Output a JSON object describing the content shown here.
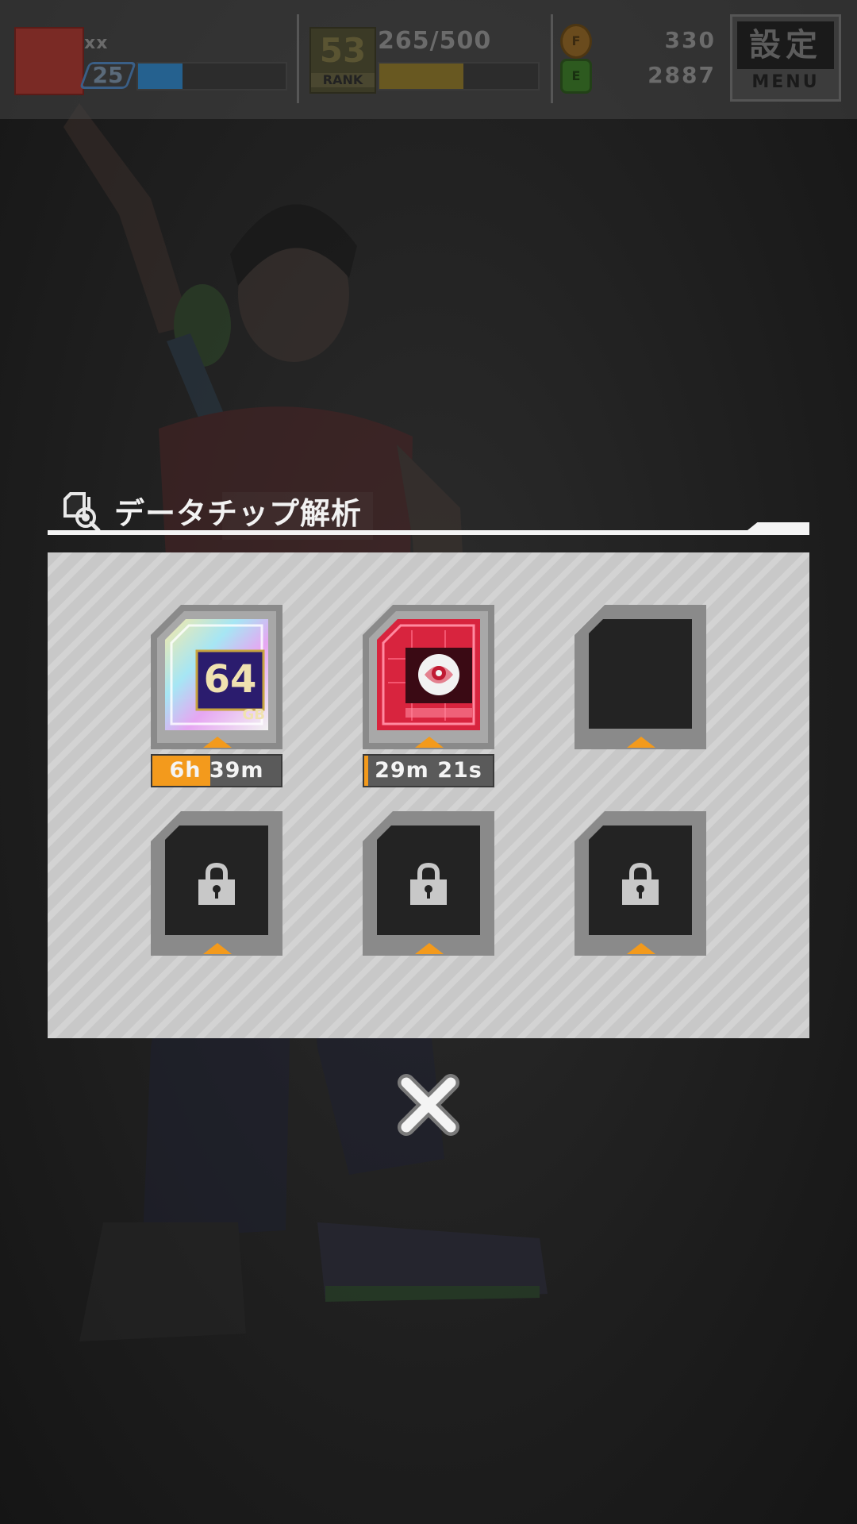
{
  "hud": {
    "player_name": "xx",
    "player_level": "25",
    "exp_progress": 0.3,
    "rank": {
      "number": "53",
      "label": "RANK"
    },
    "stamina_text": "265/500",
    "stamina_progress": 0.53,
    "currencies": [
      {
        "icon": "f-coin-icon",
        "letter": "F",
        "value": "330"
      },
      {
        "icon": "e-can-icon",
        "letter": "E",
        "value": "2887"
      }
    ],
    "menu": {
      "kanji": "設定",
      "label": "MENU"
    }
  },
  "modal": {
    "title": "データチップ解析",
    "title_icon": "chip-search-icon",
    "slots": [
      {
        "state": "analyzing",
        "chip": "64gb-chip",
        "chip_text": "64",
        "chip_unit": "GB",
        "timer": "6h 39m",
        "timer_progress": 0.45
      },
      {
        "state": "analyzing",
        "chip": "rose-chip",
        "timer": "29m 21s",
        "timer_progress": 0.03
      },
      {
        "state": "empty"
      },
      {
        "state": "locked"
      },
      {
        "state": "locked"
      },
      {
        "state": "locked"
      }
    ],
    "close_icon": "close-icon"
  },
  "colors": {
    "accent_orange": "#f39a1c",
    "panel_light": "#d3d3d3",
    "panel_stripe": "#c8c8c8",
    "slot_dark": "#232323"
  }
}
